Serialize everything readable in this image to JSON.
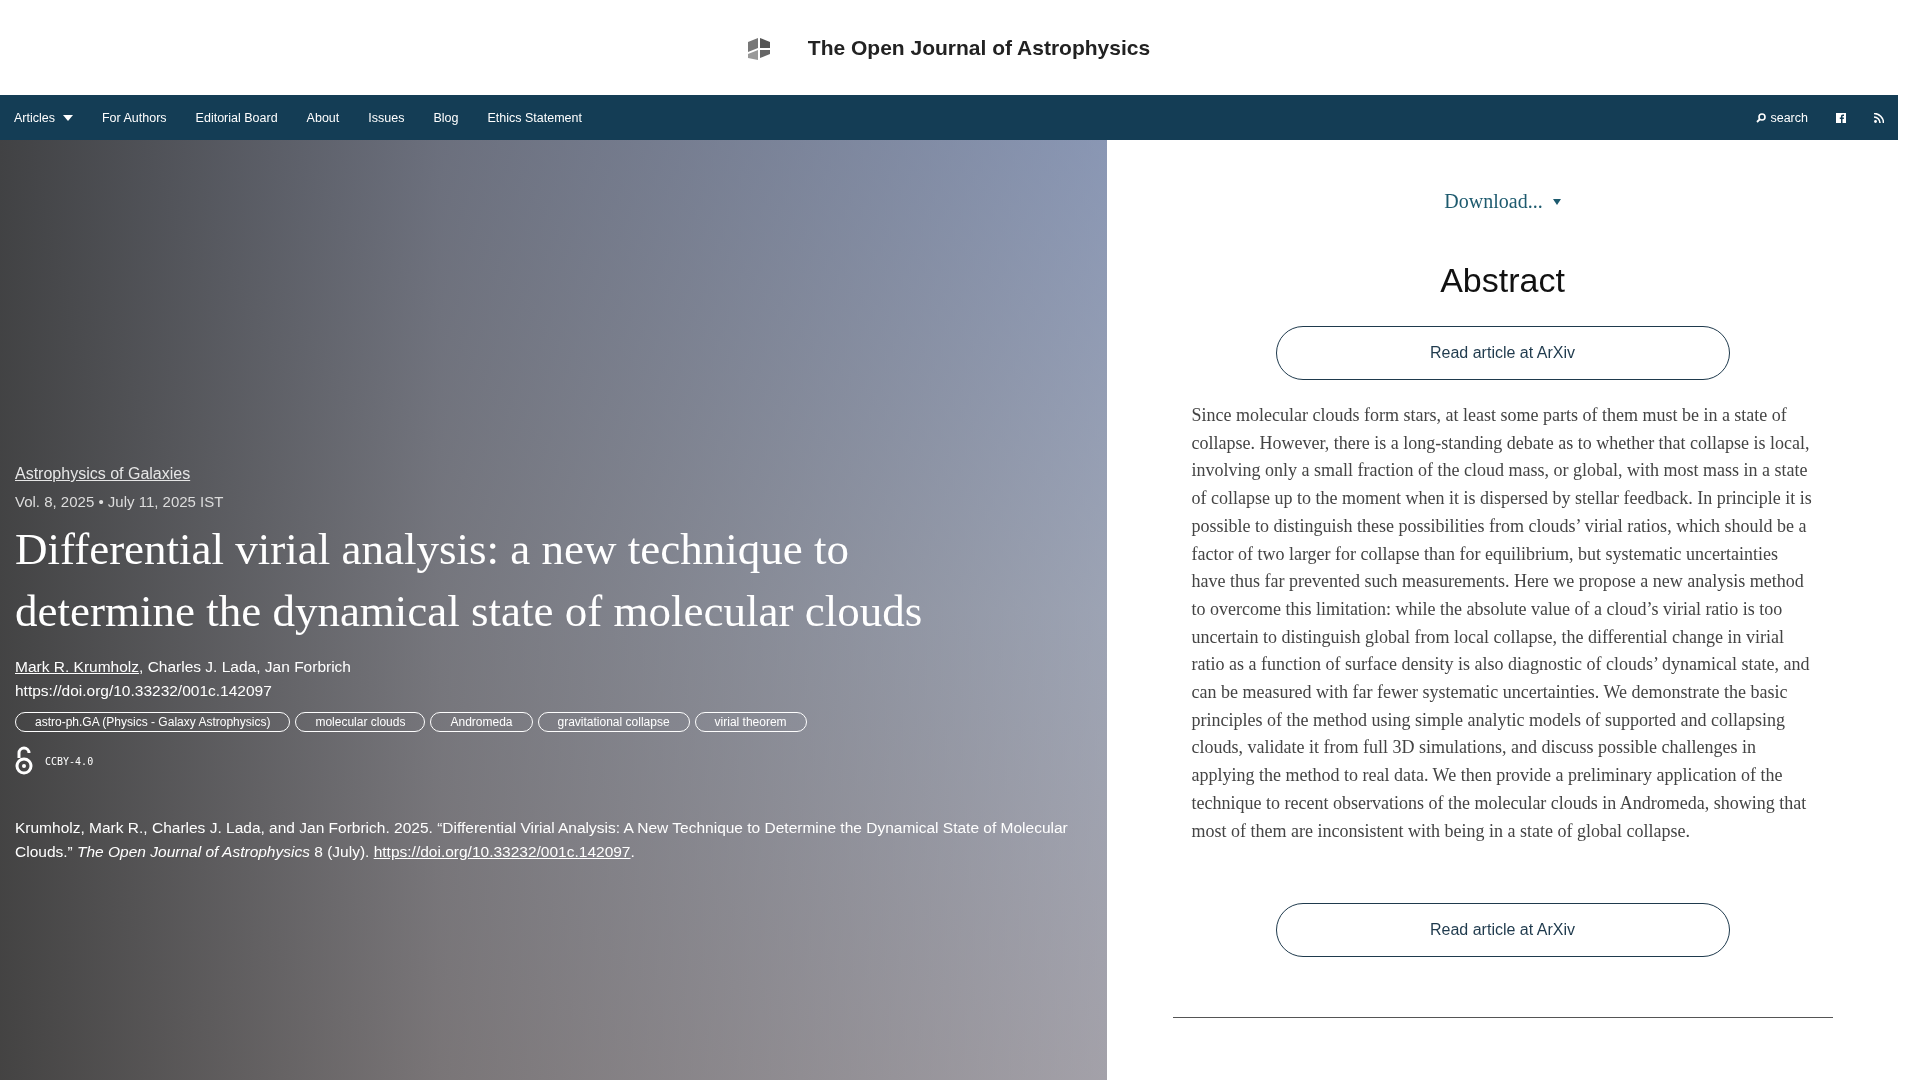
{
  "site": {
    "title": "The Open Journal of Astrophysics"
  },
  "nav": {
    "items": [
      {
        "label": "Articles",
        "dropdown": true
      },
      {
        "label": "For Authors",
        "dropdown": false
      },
      {
        "label": "Editorial Board",
        "dropdown": false
      },
      {
        "label": "About",
        "dropdown": false
      },
      {
        "label": "Issues",
        "dropdown": false
      },
      {
        "label": "Blog",
        "dropdown": false
      },
      {
        "label": "Ethics Statement",
        "dropdown": false
      }
    ],
    "search": "search"
  },
  "article": {
    "section": "Astrophysics of Galaxies",
    "meta": "Vol. 8, 2025 • July 11, 2025 IST",
    "title": "Differential virial analysis: a new technique to determine the dynamical state of molecular clouds",
    "authors": [
      {
        "name": "Mark R. Krumholz",
        "linked": true
      },
      {
        "name": "Charles J. Lada",
        "linked": false
      },
      {
        "name": "Jan Forbrich",
        "linked": false
      }
    ],
    "author_separator": ", ",
    "doi": "https://doi.org/10.33232/001c.142097",
    "tags": [
      "astro-ph.GA (Physics - Galaxy Astrophysics)",
      "molecular clouds",
      "Andromeda",
      "gravitational collapse",
      "virial theorem"
    ],
    "license": "CCBY-4.0",
    "citation": {
      "text": "Krumholz, Mark R., Charles J. Lada, and Jan Forbrich. 2025. “Differential Virial Analysis: A New Technique to Determine the Dynamical State of Molecular Clouds.” ",
      "journal": "The Open Journal of Astrophysics",
      "rest": " 8 (July). ",
      "link": "https://doi.org/10.33232/001c.142097",
      "end": "."
    }
  },
  "side": {
    "download": "Download...",
    "heading": "Abstract",
    "buttons": [
      "Read article at ArXiv",
      "Read article at ArXiv"
    ],
    "abstract": "Since molecular clouds form stars, at least some parts of them must be in a state of collapse. However, there is a long-standing debate as to whether that collapse is local, involving only a small fraction of the cloud mass, or global, with most mass in a state of collapse up to the moment when it is dispersed by stellar feedback. In principle it is possible to distinguish these possibilities from clouds’ virial ratios, which should be a factor of two larger for collapse than for equilibrium, but systematic uncertainties have thus far prevented such measurements. Here we propose a new analysis method to overcome this limitation: while the absolute value of a cloud’s virial ratio is too uncertain to distinguish global from local collapse, the differential change in virial ratio as a function of surface density is also diagnostic of clouds’ dynamical state, and can be measured with far fewer systematic uncertainties. We demonstrate the basic principles of the method using simple analytic models of supported and collapsing clouds, validate it from full 3D simulations, and discuss possible challenges in applying the method to real data. We then provide a preliminary application of the technique to recent observations of the molecular clouds in Andromeda, showing that most of them are inconsistent with being in a state of global collapse."
  }
}
